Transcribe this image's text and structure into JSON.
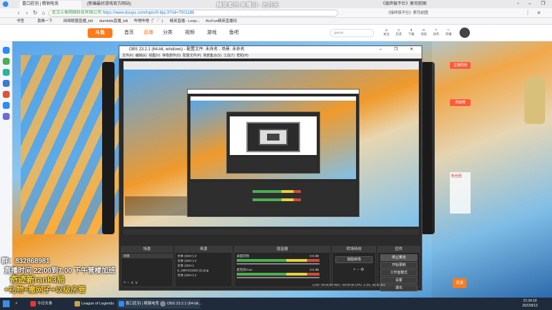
{
  "browser": {
    "tabs": [
      {
        "label": "喜口莊羽 | 精钢电竞"
      },
      {
        "label": "(新编最好游戏官方网站)"
      },
      {
        "label": "《接终极不仕》索司前图"
      }
    ],
    "url": "https://www.douyu.com/topic/h-bjq-3?rid=7001186",
    "url_prefix": "武汉斗鱼网络科技有限公司",
    "overlay_title": "精英卖艺·直播间 · 五月天",
    "bookmarks": [
      "书签",
      "喜推一下",
      "网络联盟直播_bili",
      "dumkids直播_bili",
      "哔哩哔哩（゜-゜)",
      "精英直播 - Lesp...",
      "ArcFun精英直播间"
    ]
  },
  "site": {
    "logo": "斗鱼",
    "nav": [
      "首页",
      "直播",
      "分类",
      "视频",
      "游戏",
      "鱼吧"
    ],
    "search_placeholder": "game",
    "header_icons": [
      "关注",
      "历史",
      "下载",
      "消息",
      "创作",
      "开播"
    ]
  },
  "obs": {
    "title": "OBS 23.2.1 (64-bit, windows) - 配置文件: 未命名 - 场景: 未命名",
    "menu": [
      "文件(F)",
      "编辑(E)",
      "视图(V)",
      "停靠部件(D)",
      "配置文件(P)",
      "场景集合(S)",
      "工具(T)",
      "帮助(H)"
    ],
    "docks": {
      "scenes": "场景",
      "sources": "来源",
      "mixer": "混音器",
      "transitions": "转场特效",
      "controls": "控件"
    },
    "scene_item": "场景",
    "sources": [
      "文本 (GDI+) 3",
      "文本 (GDI+) 2",
      "文本 (GDI+)",
      "5_1887211502 (1).png",
      "文本 (GDI+) 4"
    ],
    "mixer": [
      {
        "name": "桌面音频",
        "db": "0.0 dB"
      },
      {
        "name": "麦克风/Aux",
        "db": "0.0 dB"
      }
    ],
    "transition": "渐隐转场",
    "controls": [
      "停止推流",
      "开始录制",
      "工作室模式",
      "设置",
      "退出"
    ],
    "status": "LIVE: 00:00:00   REC: 00:00:00   CPU: 4.3%, 60.00 fps"
  },
  "overlay": {
    "line1": "群：832868981",
    "line2": "直播时间 22:00到7:00 下午营楼加班",
    "line3": "奇迹新rank3局",
    "line4": "+礼物+撒网子+以级房管"
  },
  "right_panel": [
    "主播周榜",
    "贡献榜",
    "粉丝团",
    "发送"
  ],
  "taskbar": {
    "items": [
      "今日头条",
      "League of Legends",
      "喜口莊羽 | 精钢电竞...",
      "OBS 23.2.1 (64-bit..."
    ],
    "time": "21:34:18",
    "date": "2022/8/13"
  },
  "colors": {
    "accent": "#ff7a1a",
    "live_red": "#d84a3a",
    "obs_bg": "#2b2b2b",
    "taskbar": "#1f2b3a"
  }
}
